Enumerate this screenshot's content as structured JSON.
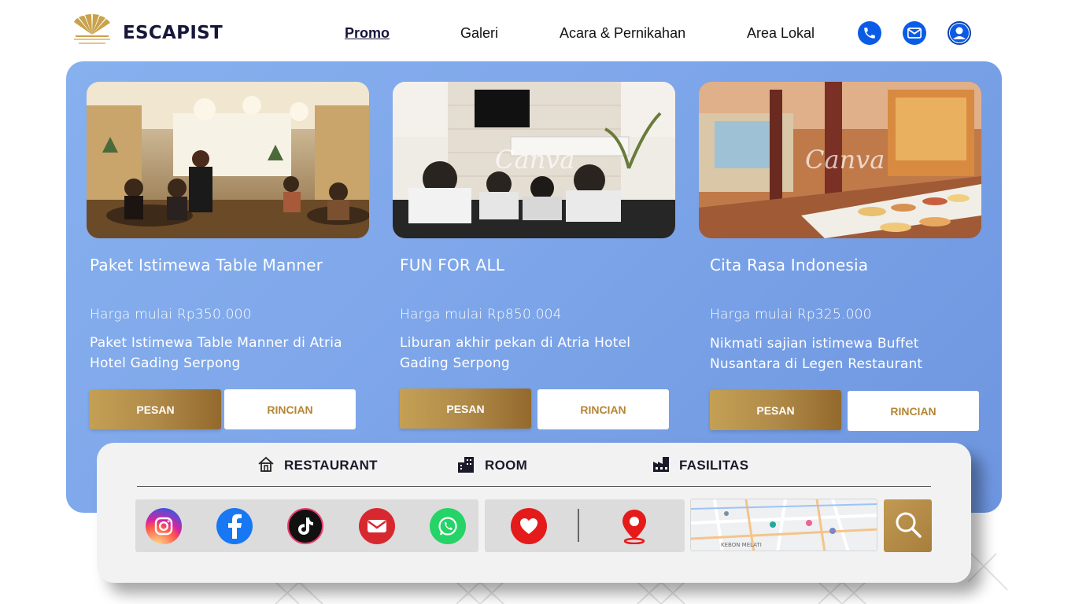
{
  "header": {
    "brand": "ESCAPIST",
    "logo_icon": "mandarin-oriental-fan-logo",
    "nav": [
      {
        "label": "Promo",
        "active": true
      },
      {
        "label": "Galeri",
        "active": false
      },
      {
        "label": "Acara & Pernikahan",
        "active": false
      },
      {
        "label": "Area Lokal",
        "active": false
      }
    ],
    "icons": [
      "phone-icon",
      "mail-icon",
      "user-icon"
    ]
  },
  "promos": [
    {
      "image": "restaurant-dining-photo",
      "title": "Paket Istimewa Table Manner",
      "price": "Harga mulai Rp350.000",
      "description": "Paket Istimewa Table Manner di Atria Hotel Gading Serpong",
      "order_label": "PESAN",
      "details_label": "RINCIAN"
    },
    {
      "image": "family-tv-photo",
      "title": "FUN FOR ALL",
      "price": "Harga mulai Rp850.004",
      "description": "Liburan akhir pekan di Atria Hotel Gading Serpong",
      "order_label": "PESAN",
      "details_label": "RINCIAN"
    },
    {
      "image": "buffet-restaurant-photo",
      "title": "Cita Rasa Indonesia",
      "price": "Harga mulai Rp325.000",
      "description": "Nikmati sajian istimewa Buffet Nusantara di Legen Restaurant",
      "order_label": "PESAN",
      "details_label": "RINCIAN"
    }
  ],
  "categories": [
    {
      "icon": "restaurant-home-icon",
      "label": "RESTAURANT"
    },
    {
      "icon": "room-building-icon",
      "label": "ROOM"
    },
    {
      "icon": "facility-factory-icon",
      "label": "FASILITAS"
    }
  ],
  "social": [
    "instagram-icon",
    "facebook-icon",
    "tiktok-icon",
    "email-icon",
    "whatsapp-icon"
  ],
  "quick": [
    "favorite-heart-icon",
    "location-pin-icon"
  ],
  "map": {
    "label": "KEBON MELATI"
  },
  "search_icon": "search-icon",
  "colors": {
    "accent_blue": "#0a5ce6",
    "panel_blue": "#7fa7ea",
    "gold": "#b08a48",
    "brand_navy": "#16183a"
  }
}
